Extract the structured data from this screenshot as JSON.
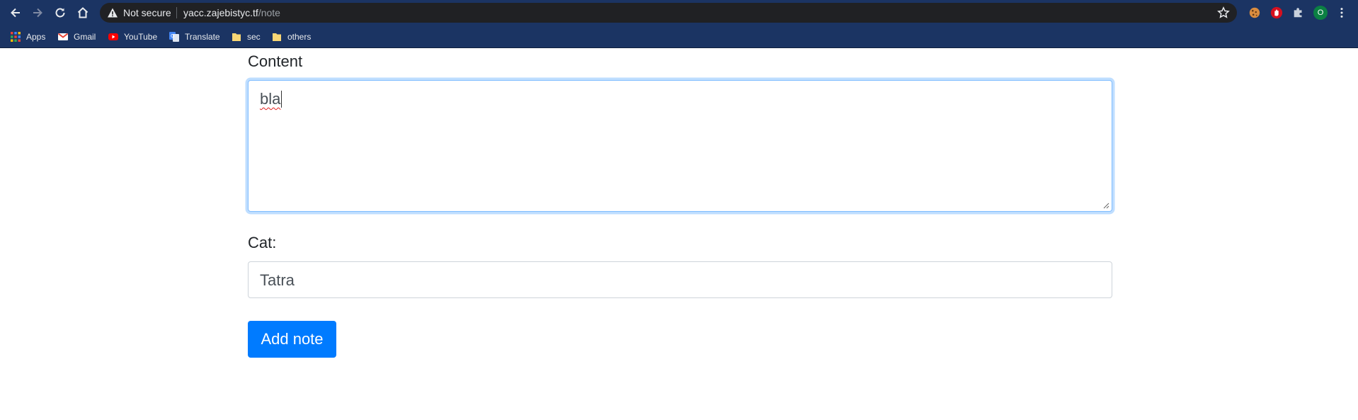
{
  "browser": {
    "security_label": "Not secure",
    "url_host": "yacc.zajebistyc.tf",
    "url_path": "/note",
    "profile_initial": "O",
    "bookmarks": [
      {
        "label": "Apps",
        "icon": "apps-grid-icon"
      },
      {
        "label": "Gmail",
        "icon": "gmail-icon"
      },
      {
        "label": "YouTube",
        "icon": "youtube-icon"
      },
      {
        "label": "Translate",
        "icon": "translate-icon"
      },
      {
        "label": "sec",
        "icon": "folder-icon"
      },
      {
        "label": "others",
        "icon": "folder-icon"
      }
    ],
    "extension_icons": [
      "cookie-icon",
      "stop-hand-icon",
      "puzzle-extensions-icon"
    ]
  },
  "form": {
    "content_label": "Content",
    "content_value": "bla",
    "cat_label": "Cat:",
    "cat_value": "Tatra",
    "submit_label": "Add note"
  },
  "colors": {
    "chrome": "#1b3463",
    "primary": "#007bff",
    "focus_border": "#80bdff"
  }
}
